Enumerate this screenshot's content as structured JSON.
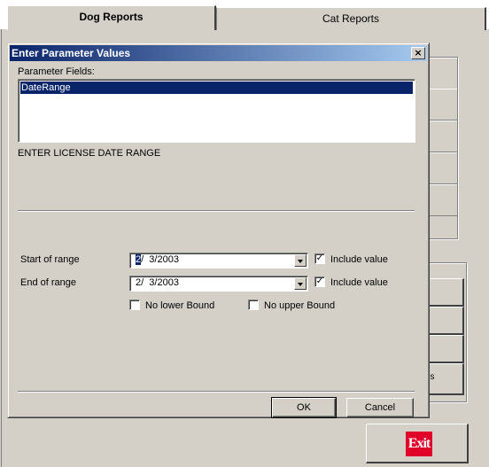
{
  "tabs": [
    {
      "label": "Dog Reports",
      "active": true
    },
    {
      "label": "Cat Reports",
      "active": false
    }
  ],
  "background": {
    "partial_button_text": "gs",
    "exit_label": "Exit"
  },
  "dialog": {
    "title": "Enter Parameter Values",
    "close_glyph": "×",
    "parameter_fields_label": "Parameter Fields:",
    "parameter_fields": [
      "DateRange"
    ],
    "prompt_text": "ENTER LICENSE DATE RANGE",
    "start": {
      "label": "Start of range",
      "value_prefix": "2",
      "value_rest": "/  3/2003",
      "include_label": "Include value",
      "include_checked": true
    },
    "end": {
      "label": "End of range",
      "value": "2/  3/2003",
      "include_label": "Include value",
      "include_checked": true
    },
    "no_lower_label": "No lower Bound",
    "no_upper_label": "No upper Bound",
    "ok_label": "OK",
    "cancel_label": "Cancel"
  }
}
